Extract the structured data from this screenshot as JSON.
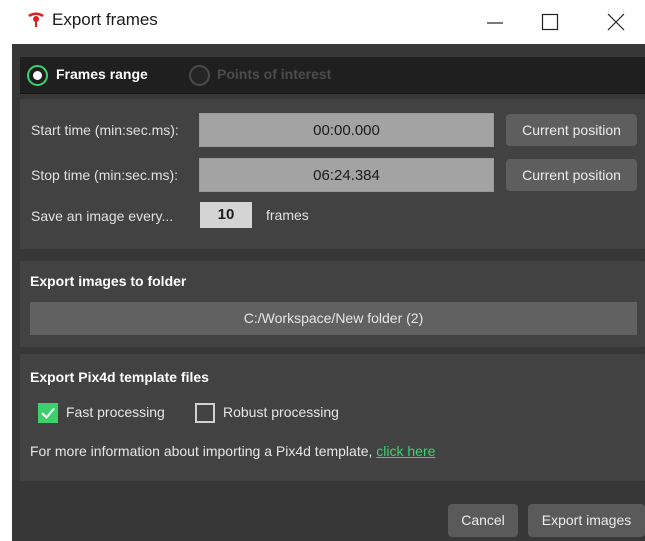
{
  "window": {
    "title": "Export frames",
    "accent_color": "#3dd16e",
    "brand_color": "#e02020"
  },
  "tabs": [
    {
      "label": "Frames range",
      "selected": true
    },
    {
      "label": "Points of interest",
      "selected": false
    }
  ],
  "time_range": {
    "start_label": "Start time (min:sec.ms):",
    "start_value": "00:00.000",
    "stop_label": "Stop time (min:sec.ms):",
    "stop_value": "06:24.384",
    "current_position_label": "Current position",
    "save_every_label": "Save an image every...",
    "save_every_value": "10",
    "frames_label": "frames"
  },
  "export_folder": {
    "title": "Export images to folder",
    "path": "C:/Workspace/New folder (2)"
  },
  "pix4d": {
    "title": "Export Pix4d template files",
    "fast_label": "Fast processing",
    "fast_checked": true,
    "robust_label": "Robust processing",
    "robust_checked": false,
    "info_text": "For more information about importing a Pix4d template,",
    "link_text": "click here"
  },
  "footer": {
    "cancel_label": "Cancel",
    "export_label": "Export images"
  }
}
